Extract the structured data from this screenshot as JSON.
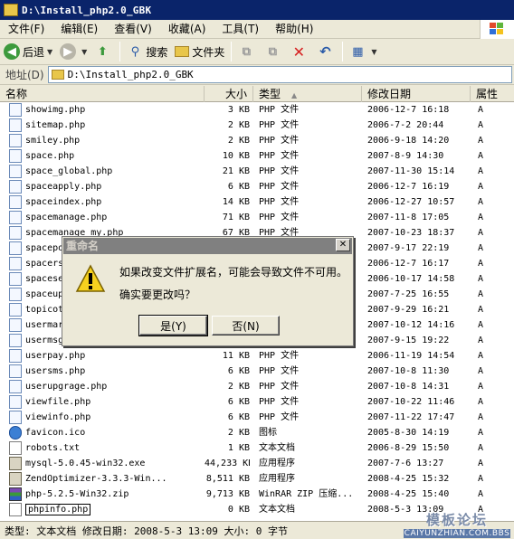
{
  "window": {
    "title": "D:\\Install_php2.0_GBK"
  },
  "menu": [
    "文件(F)",
    "编辑(E)",
    "查看(V)",
    "收藏(A)",
    "工具(T)",
    "帮助(H)"
  ],
  "toolbar": {
    "back": "后退",
    "search": "搜索",
    "folders": "文件夹"
  },
  "address": {
    "label": "地址(D)",
    "path": "D:\\Install_php2.0_GBK"
  },
  "columns": {
    "name": "名称",
    "size": "大小",
    "type": "类型",
    "modified": "修改日期",
    "attrs": "属性"
  },
  "files": [
    {
      "name": "showimg.php",
      "size": "3 KB",
      "type": "PHP 文件",
      "modified": "2006-12-7 16:18",
      "attr": "A",
      "icon": "php"
    },
    {
      "name": "sitemap.php",
      "size": "2 KB",
      "type": "PHP 文件",
      "modified": "2006-7-2 20:44",
      "attr": "A",
      "icon": "php"
    },
    {
      "name": "smiley.php",
      "size": "2 KB",
      "type": "PHP 文件",
      "modified": "2006-9-18 14:20",
      "attr": "A",
      "icon": "php"
    },
    {
      "name": "space.php",
      "size": "10 KB",
      "type": "PHP 文件",
      "modified": "2007-8-9 14:30",
      "attr": "A",
      "icon": "php"
    },
    {
      "name": "space_global.php",
      "size": "21 KB",
      "type": "PHP 文件",
      "modified": "2007-11-30 15:14",
      "attr": "A",
      "icon": "php"
    },
    {
      "name": "spaceapply.php",
      "size": "6 KB",
      "type": "PHP 文件",
      "modified": "2006-12-7 16:19",
      "attr": "A",
      "icon": "php"
    },
    {
      "name": "spaceindex.php",
      "size": "14 KB",
      "type": "PHP 文件",
      "modified": "2006-12-27 10:57",
      "attr": "A",
      "icon": "php"
    },
    {
      "name": "spacemanage.php",
      "size": "71 KB",
      "type": "PHP 文件",
      "modified": "2007-11-8 17:05",
      "attr": "A",
      "icon": "php"
    },
    {
      "name": "spacemanage_my.php",
      "size": "67 KB",
      "type": "PHP 文件",
      "modified": "2007-10-23 18:37",
      "attr": "A",
      "icon": "php"
    },
    {
      "name": "spacepo",
      "size": "",
      "type": "",
      "modified": "2007-9-17 22:19",
      "attr": "A",
      "icon": "php"
    },
    {
      "name": "spacers",
      "size": "",
      "type": "",
      "modified": "2006-12-7 16:17",
      "attr": "A",
      "icon": "php"
    },
    {
      "name": "spacese",
      "size": "",
      "type": "",
      "modified": "2006-10-17 14:58",
      "attr": "A",
      "icon": "php"
    },
    {
      "name": "spaceup",
      "size": "",
      "type": "",
      "modified": "2007-7-25 16:55",
      "attr": "A",
      "icon": "php"
    },
    {
      "name": "topicot",
      "size": "",
      "type": "",
      "modified": "2007-9-29 16:21",
      "attr": "A",
      "icon": "php"
    },
    {
      "name": "usermar",
      "size": "",
      "type": "",
      "modified": "2007-10-12 14:16",
      "attr": "A",
      "icon": "php"
    },
    {
      "name": "usermsg",
      "size": "",
      "type": "",
      "modified": "2007-9-15 19:22",
      "attr": "A",
      "icon": "php"
    },
    {
      "name": "userpay.php",
      "size": "11 KB",
      "type": "PHP 文件",
      "modified": "2006-11-19 14:54",
      "attr": "A",
      "icon": "php"
    },
    {
      "name": "usersms.php",
      "size": "6 KB",
      "type": "PHP 文件",
      "modified": "2007-10-8 11:30",
      "attr": "A",
      "icon": "php"
    },
    {
      "name": "userupgrage.php",
      "size": "2 KB",
      "type": "PHP 文件",
      "modified": "2007-10-8 14:31",
      "attr": "A",
      "icon": "php"
    },
    {
      "name": "viewfile.php",
      "size": "6 KB",
      "type": "PHP 文件",
      "modified": "2007-10-22 11:46",
      "attr": "A",
      "icon": "php"
    },
    {
      "name": "viewinfo.php",
      "size": "6 KB",
      "type": "PHP 文件",
      "modified": "2007-11-22 17:47",
      "attr": "A",
      "icon": "php"
    },
    {
      "name": "favicon.ico",
      "size": "2 KB",
      "type": "图标",
      "modified": "2005-8-30 14:19",
      "attr": "A",
      "icon": "ico"
    },
    {
      "name": "robots.txt",
      "size": "1 KB",
      "type": "文本文档",
      "modified": "2006-8-29 15:50",
      "attr": "A",
      "icon": "txt"
    },
    {
      "name": "mysql-5.0.45-win32.exe",
      "size": "44,233 KB",
      "type": "应用程序",
      "modified": "2007-7-6 13:27",
      "attr": "A",
      "icon": "exe"
    },
    {
      "name": "ZendOptimizer-3.3.3-Win...",
      "size": "8,511 KB",
      "type": "应用程序",
      "modified": "2008-4-25 15:32",
      "attr": "A",
      "icon": "exe"
    },
    {
      "name": "php-5.2.5-Win32.zip",
      "size": "9,713 KB",
      "type": "WinRAR ZIP 压缩...",
      "modified": "2008-4-25 15:40",
      "attr": "A",
      "icon": "zip"
    },
    {
      "name": "phpinfo.php",
      "size": "0 KB",
      "type": "文本文档",
      "modified": "2008-5-3 13:09",
      "attr": "A",
      "icon": "txt",
      "editing": true
    }
  ],
  "dialog": {
    "title": "重命名",
    "message": "如果改变文件扩展名，可能会导致文件不可用。",
    "question": "确实要更改吗？",
    "yes": "是(Y)",
    "no": "否(N)"
  },
  "status": {
    "text": "类型: 文本文档 修改日期: 2008-5-3 13:09 大小: 0 字节"
  },
  "watermark": {
    "line1": "模板论坛",
    "line2": "CAIYUNZHIAN.COM.BBS"
  }
}
